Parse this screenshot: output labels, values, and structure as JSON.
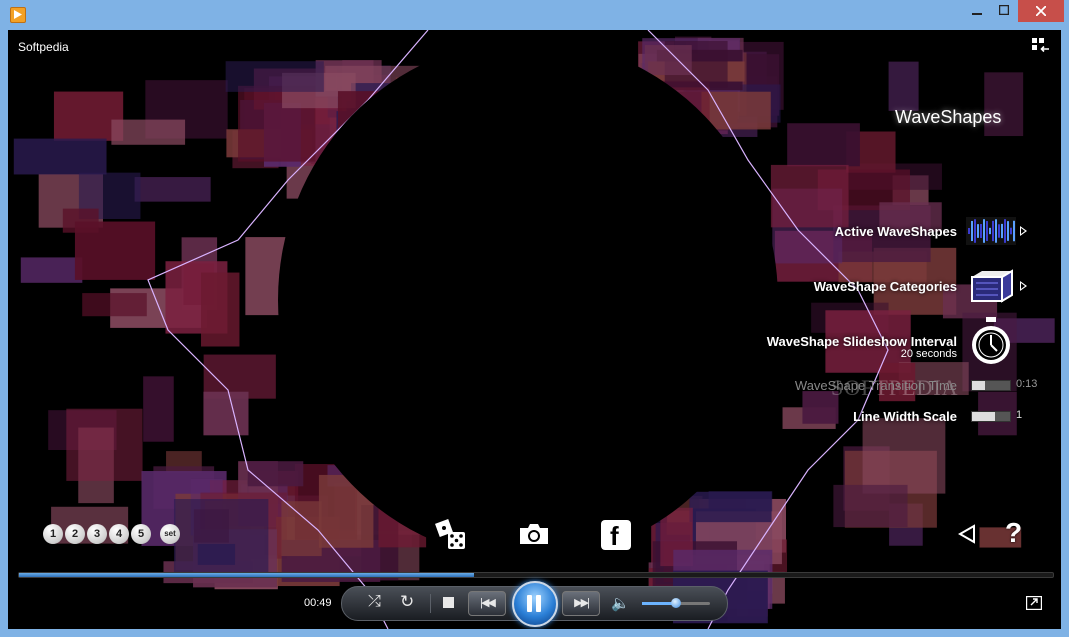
{
  "window": {
    "app_icon": "media-player-icon",
    "min_icon": "minimize-icon",
    "max_icon": "maximize-icon",
    "close_icon": "close-icon"
  },
  "media_title": "Softpedia",
  "watermark": "SOFTPEDIA",
  "menu": {
    "header": "WaveShapes",
    "items": [
      {
        "label": "Active WaveShapes",
        "icon": "waveform-icon",
        "has_arrow": true
      },
      {
        "label": "WaveShape Categories",
        "icon": "cube-icon",
        "has_arrow": true
      },
      {
        "label": "WaveShape Slideshow Interval",
        "sub": "20 seconds",
        "icon": "stopwatch-icon"
      }
    ],
    "sliders": [
      {
        "label": "WaveShape Transition Time",
        "value": "0:13",
        "level": 0.35,
        "dimmed": true
      },
      {
        "label": "Line Width Scale",
        "value": "1",
        "level": 0.6,
        "dimmed": false
      }
    ]
  },
  "rating": {
    "stars": [
      "1",
      "2",
      "3",
      "4",
      "5"
    ],
    "set_label": "set"
  },
  "overlay_icons": [
    "dice-icon",
    "camera-icon",
    "facebook-icon",
    "back-arrow-icon",
    "help-icon"
  ],
  "facebook_glyph": "f",
  "help_glyph": "?",
  "seek": {
    "progress": 0.44
  },
  "transport": {
    "current_time": "00:49",
    "volume_level": 0.5,
    "shuffle_glyph": "⤮",
    "repeat_glyph": "↻",
    "prev_glyph": "|◀◀",
    "next_glyph": "▶▶|",
    "volume_glyph": "🔈"
  },
  "colors": {
    "accent": "#2b7fd6",
    "frame": "#7fb2e5",
    "close": "#c74f4a",
    "viz_line": "#d9b3ff"
  }
}
